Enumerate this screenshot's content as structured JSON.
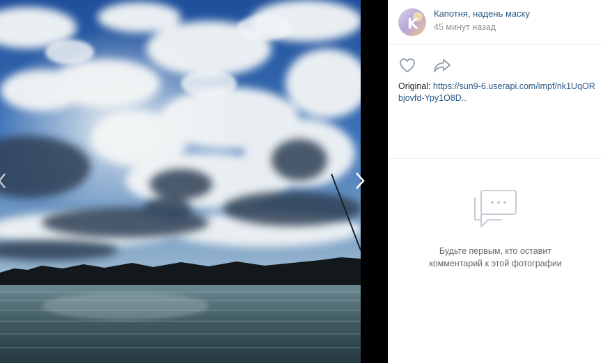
{
  "author": {
    "name": "Капотня, надень маску",
    "time": "45 минут назад",
    "avatar_letter": "K"
  },
  "actions": {
    "like_icon": "heart-icon",
    "share_icon": "share-arrow-icon"
  },
  "original": {
    "label": "Original:",
    "url": "https://sun9-6.userapi.com/impf/nk1UqORbjovfd-Ypy1O8D.."
  },
  "comments": {
    "icon": "comments-icon",
    "empty_line1": "Будьте первым, кто оставит",
    "empty_line2": "комментарий к этой фотографии"
  },
  "nav": {
    "prev_icon": "chevron-left-icon",
    "next_icon": "chevron-right-icon"
  },
  "colors": {
    "link": "#2a5885",
    "muted": "#939393",
    "divider": "#e7e8ec",
    "viewer_bg": "#000000"
  }
}
